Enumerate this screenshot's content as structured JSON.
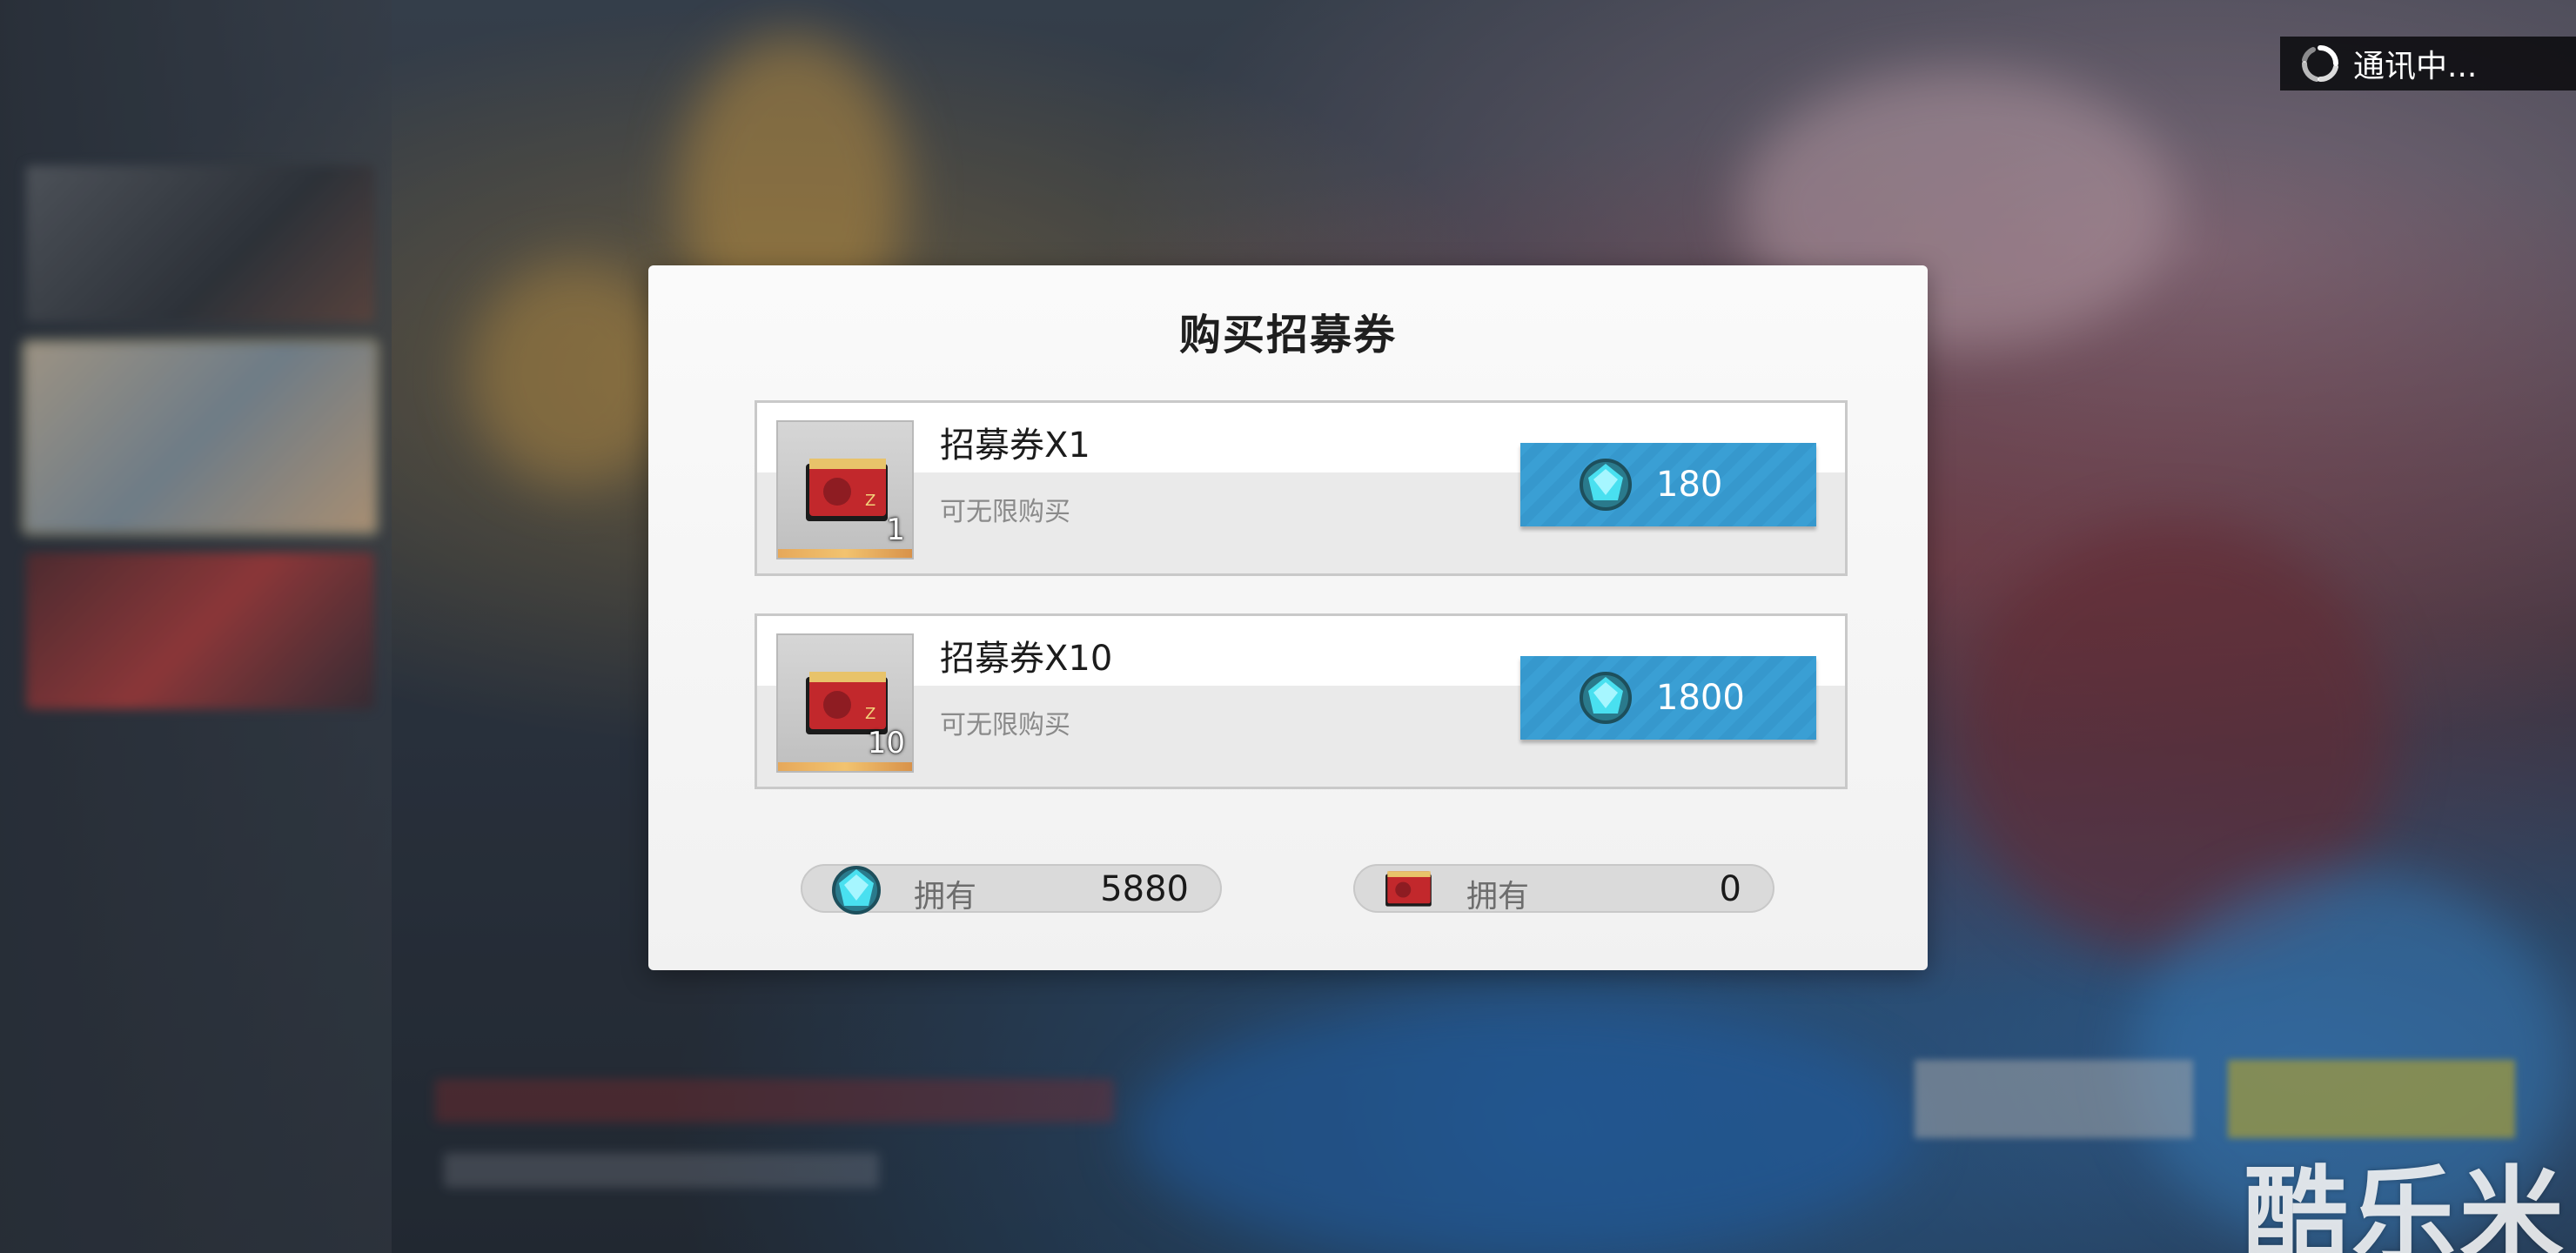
{
  "status": {
    "text": "通讯中..."
  },
  "modal": {
    "title": "购买招募券",
    "items": [
      {
        "name": "招募券X1",
        "note": "可无限购买",
        "quantity": "1",
        "price": "180",
        "currency_icon": "gem-icon",
        "item_icon": "recruit-ticket-icon"
      },
      {
        "name": "招募券X10",
        "note": "可无限购买",
        "quantity": "10",
        "price": "1800",
        "currency_icon": "gem-icon",
        "item_icon": "recruit-ticket-icon"
      }
    ],
    "owned": [
      {
        "icon": "gem-icon",
        "label": "拥有",
        "value": "5880"
      },
      {
        "icon": "recruit-ticket-icon",
        "label": "拥有",
        "value": "0"
      }
    ]
  },
  "watermark": "酷乐米",
  "colors": {
    "buy_button": "#3a9fd4",
    "modal_bg": "#f4f4f4",
    "gem": "#3fd6e6"
  }
}
